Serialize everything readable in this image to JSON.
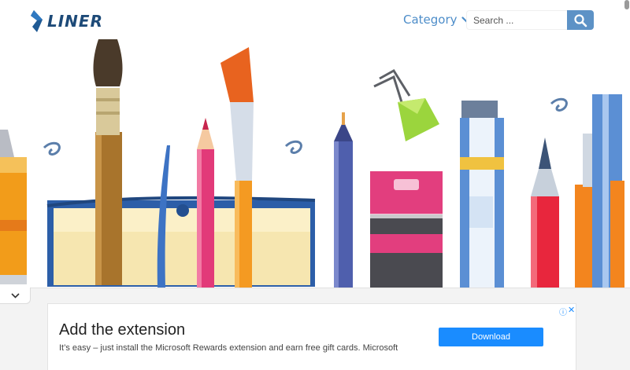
{
  "header": {
    "logo_text": "LINER",
    "category_label": "Category",
    "search_placeholder": "Search ...",
    "brand_color": "#1d4a78",
    "accent_color": "#5d92c6"
  },
  "hero": {
    "image_name": "art-supplies-illustration",
    "items": [
      "sketchbook",
      "paint-brush",
      "flat-brush",
      "pencil",
      "fineliner-pen",
      "paint-tube-pink",
      "binder-clip",
      "paint-tube-blue",
      "fountain-pen",
      "marker"
    ]
  },
  "ad": {
    "title": "Add the extension",
    "description": "It’s easy – just install the Microsoft Rewards extension and earn free gift cards. Microsoft",
    "button_label": "Download",
    "info_icon": "ⓘ",
    "close_icon": "✕",
    "button_color": "#1a8cff"
  }
}
